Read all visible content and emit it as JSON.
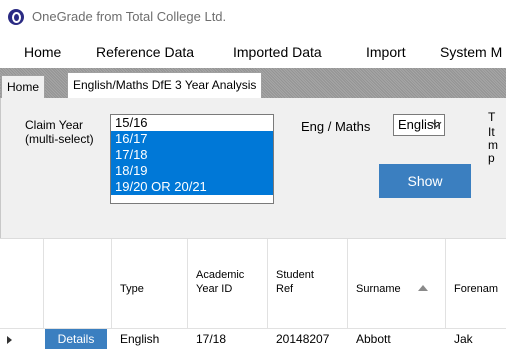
{
  "window": {
    "title": "OneGrade from Total College Ltd."
  },
  "menu": [
    "Home",
    "Reference Data",
    "Imported Data",
    "Import",
    "System M"
  ],
  "tabs": [
    {
      "label": "Home",
      "active": false
    },
    {
      "label": "English/Maths DfE 3 Year Analysis",
      "active": true
    }
  ],
  "filters": {
    "claim_year_label": "Claim Year",
    "claim_year_sub": "(multi-select)",
    "claim_years": [
      {
        "label": "15/16",
        "selected": false
      },
      {
        "label": "16/17",
        "selected": true
      },
      {
        "label": "17/18",
        "selected": true
      },
      {
        "label": "18/19",
        "selected": true
      },
      {
        "label": "19/20 OR 20/21",
        "selected": true
      }
    ],
    "eng_maths_label": "Eng / Maths",
    "eng_maths_value": "English",
    "show_label": "Show",
    "side_text": [
      "T",
      "It",
      "m",
      "p"
    ]
  },
  "grid": {
    "columns": [
      "Type",
      "Academic Year ID",
      "Student Ref",
      "Surname",
      "Forenam"
    ],
    "sort_column": "Surname",
    "first_row": {
      "details": "Details",
      "type": "English",
      "academic_year": "17/18",
      "student_ref": "20148207",
      "surname": "Abbott",
      "forename": "Jak"
    }
  },
  "colors": {
    "selection": "#0078d7",
    "button": "#3b7fc0",
    "panel": "#f0f0f0"
  }
}
